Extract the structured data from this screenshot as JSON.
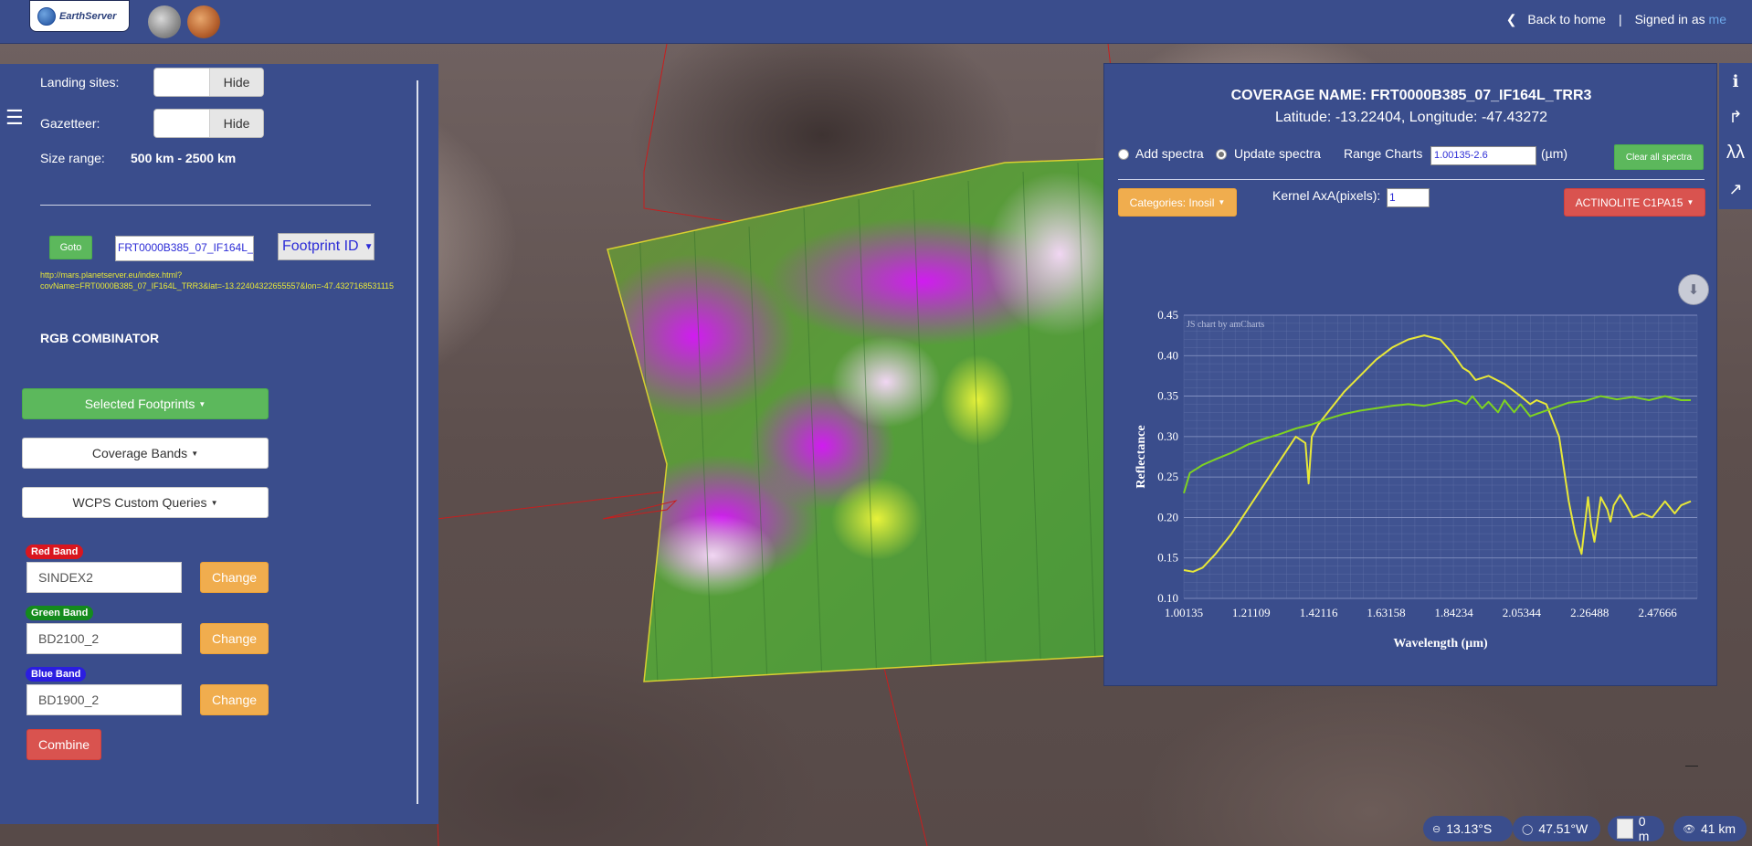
{
  "header": {
    "logo_text": "EarthServer",
    "back_to_home": "Back to home",
    "separator": "|",
    "signed_in_as": "Signed in as",
    "user": "me"
  },
  "left_panel": {
    "landing_sites_label": "Landing sites:",
    "landing_sites_button": "Hide",
    "gazetteer_label": "Gazetteer:",
    "gazetteer_button": "Hide",
    "size_range_label": "Size range:",
    "size_range_value": "500 km - 2500 km",
    "goto_label": "Goto",
    "coverage_input_value": "FRT0000B385_07_IF164L_",
    "footprint_select": "Footprint ID",
    "link_line1": "http://mars.planetserver.eu/index.html?",
    "link_line2": "covName=FRT0000B385_07_IF164L_TRR3&lat=-13.22404322655557&lon=-47.4327168531115",
    "rgb_title": "RGB COMBINATOR",
    "selected_footprints": "Selected Footprints",
    "coverage_bands": "Coverage Bands",
    "wcps_queries": "WCPS Custom Queries",
    "red_band_label": "Red Band",
    "red_band_value": "SINDEX2",
    "green_band_label": "Green Band",
    "green_band_value": "BD2100_2",
    "blue_band_label": "Blue Band",
    "blue_band_value": "BD1900_2",
    "change_label": "Change",
    "combine_label": "Combine"
  },
  "chart_panel": {
    "coverage_name": "COVERAGE NAME: FRT0000B385_07_IF164L_TRR3",
    "coordinates": "Latitude: -13.22404, Longitude: -47.43272",
    "add_spectra": "Add spectra",
    "update_spectra": "Update spectra",
    "range_label": "Range Charts",
    "range_value": "1.00135-2.6",
    "range_unit": "(µm)",
    "clear_all": "Clear all spectra",
    "categories": "Categories: Inosil",
    "kernel_label": "Kernel AxA(pixels):",
    "kernel_value": "1",
    "mineral": "ACTINOLITE C1PA15",
    "credit": "JS chart by amCharts"
  },
  "chart_data": {
    "type": "line",
    "xlabel": "Wavelength (µm)",
    "ylabel": "Reflectance",
    "xlim": [
      1.00135,
      2.6
    ],
    "ylim": [
      0.1,
      0.45
    ],
    "xticks": [
      "1.00135",
      "1.21109",
      "1.42116",
      "1.63158",
      "1.84234",
      "2.05344",
      "2.26488",
      "2.47666"
    ],
    "xtick_values": [
      1.00135,
      1.21109,
      1.42116,
      1.63158,
      1.84234,
      2.05344,
      2.26488,
      2.47666
    ],
    "yticks": [
      "0.45",
      "0.40",
      "0.35",
      "0.30",
      "0.25",
      "0.20",
      "0.15",
      "0.10"
    ],
    "ytick_values": [
      0.45,
      0.4,
      0.35,
      0.3,
      0.25,
      0.2,
      0.15,
      0.1
    ],
    "grid": true,
    "series": [
      {
        "color": "#e8e838",
        "x": [
          1.00135,
          1.03,
          1.06,
          1.1,
          1.15,
          1.2,
          1.25,
          1.3,
          1.35,
          1.38,
          1.39,
          1.4,
          1.42,
          1.45,
          1.5,
          1.55,
          1.6,
          1.65,
          1.7,
          1.75,
          1.8,
          1.84,
          1.87,
          1.89,
          1.91,
          1.95,
          2.0,
          2.05,
          2.08,
          2.1,
          2.13,
          2.17,
          2.2,
          2.22,
          2.24,
          2.26,
          2.27,
          2.28,
          2.3,
          2.32,
          2.33,
          2.34,
          2.36,
          2.38,
          2.4,
          2.43,
          2.46,
          2.5,
          2.53,
          2.55,
          2.58
        ],
        "y": [
          0.135,
          0.133,
          0.138,
          0.155,
          0.18,
          0.21,
          0.24,
          0.27,
          0.3,
          0.292,
          0.242,
          0.3,
          0.315,
          0.33,
          0.355,
          0.375,
          0.395,
          0.41,
          0.42,
          0.425,
          0.42,
          0.402,
          0.385,
          0.38,
          0.37,
          0.375,
          0.365,
          0.35,
          0.34,
          0.345,
          0.34,
          0.3,
          0.22,
          0.18,
          0.155,
          0.225,
          0.19,
          0.17,
          0.225,
          0.21,
          0.195,
          0.215,
          0.228,
          0.215,
          0.2,
          0.205,
          0.2,
          0.22,
          0.205,
          0.215,
          0.22
        ]
      },
      {
        "color": "#7ed321",
        "x": [
          1.00135,
          1.02,
          1.04,
          1.06,
          1.1,
          1.15,
          1.2,
          1.25,
          1.3,
          1.35,
          1.4,
          1.45,
          1.5,
          1.55,
          1.6,
          1.65,
          1.7,
          1.75,
          1.8,
          1.85,
          1.88,
          1.9,
          1.93,
          1.95,
          1.98,
          2.0,
          2.03,
          2.05,
          2.08,
          2.1,
          2.15,
          2.2,
          2.25,
          2.3,
          2.35,
          2.4,
          2.45,
          2.5,
          2.55,
          2.58
        ],
        "y": [
          0.23,
          0.255,
          0.26,
          0.265,
          0.272,
          0.28,
          0.29,
          0.297,
          0.303,
          0.31,
          0.315,
          0.322,
          0.328,
          0.332,
          0.335,
          0.338,
          0.34,
          0.338,
          0.342,
          0.345,
          0.34,
          0.35,
          0.335,
          0.343,
          0.33,
          0.345,
          0.33,
          0.34,
          0.325,
          0.328,
          0.335,
          0.342,
          0.344,
          0.35,
          0.346,
          0.349,
          0.345,
          0.35,
          0.345,
          0.345
        ]
      }
    ]
  },
  "status": {
    "lat": "13.13°S",
    "lon": "47.51°W",
    "elevation": "0 m",
    "altitude": "41 km"
  },
  "colors": {
    "panel": "#3a4d8c",
    "success": "#5cb85c",
    "warning": "#f0ad4e",
    "danger": "#d9534f"
  }
}
